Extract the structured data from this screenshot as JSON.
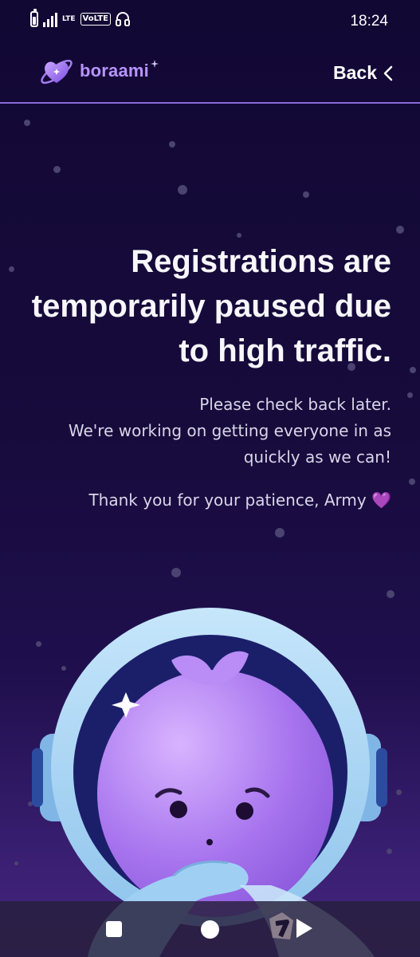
{
  "status_bar": {
    "network_label": "LTE",
    "volte_label": "VoLTE",
    "time": "18:24"
  },
  "header": {
    "logo_text": "boraami",
    "back_label": "Back",
    "accent_color": "#b894ff"
  },
  "main": {
    "headline": "Registrations are temporarily paused due to high traffic.",
    "line1": "Please check back later.",
    "line2": "We're working on getting everyone in as quickly as we can!",
    "thanks": "Thank you for your patience, Army 💜"
  },
  "illustration": {
    "name": "astronaut-mascot"
  },
  "nav_bar": {
    "items": [
      "recents-icon",
      "home-icon",
      "back-icon"
    ]
  }
}
